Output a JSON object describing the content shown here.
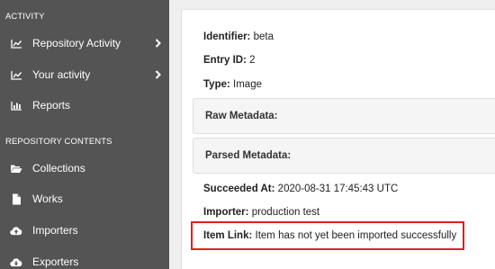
{
  "sidebar": {
    "activity_heading": "ACTIVITY",
    "activity_items": [
      {
        "label": "Repository Activity",
        "icon": "line-chart-icon",
        "has_chevron": true
      },
      {
        "label": "Your activity",
        "icon": "line-chart-icon",
        "has_chevron": true
      },
      {
        "label": "Reports",
        "icon": "bar-chart-icon",
        "has_chevron": false
      }
    ],
    "contents_heading": "REPOSITORY CONTENTS",
    "contents_items": [
      {
        "label": "Collections",
        "icon": "folder-open-icon"
      },
      {
        "label": "Works",
        "icon": "file-icon"
      },
      {
        "label": "Importers",
        "icon": "cloud-upload-icon"
      },
      {
        "label": "Exporters",
        "icon": "cloud-download-icon"
      }
    ]
  },
  "entry": {
    "identifier_label": "Identifier:",
    "identifier_value": "beta",
    "entry_id_label": "Entry ID:",
    "entry_id_value": "2",
    "type_label": "Type:",
    "type_value": "Image",
    "raw_metadata_title": "Raw Metadata:",
    "parsed_metadata_title": "Parsed Metadata:",
    "succeeded_label": "Succeeded At:",
    "succeeded_value": "2020-08-31 17:45:43 UTC",
    "importer_label": "Importer:",
    "importer_value": "production test",
    "item_link_label": "Item Link:",
    "item_link_value": "Item has not yet been imported successfully"
  },
  "colors": {
    "sidebar_bg": "#545454",
    "highlight": "#e02020"
  }
}
